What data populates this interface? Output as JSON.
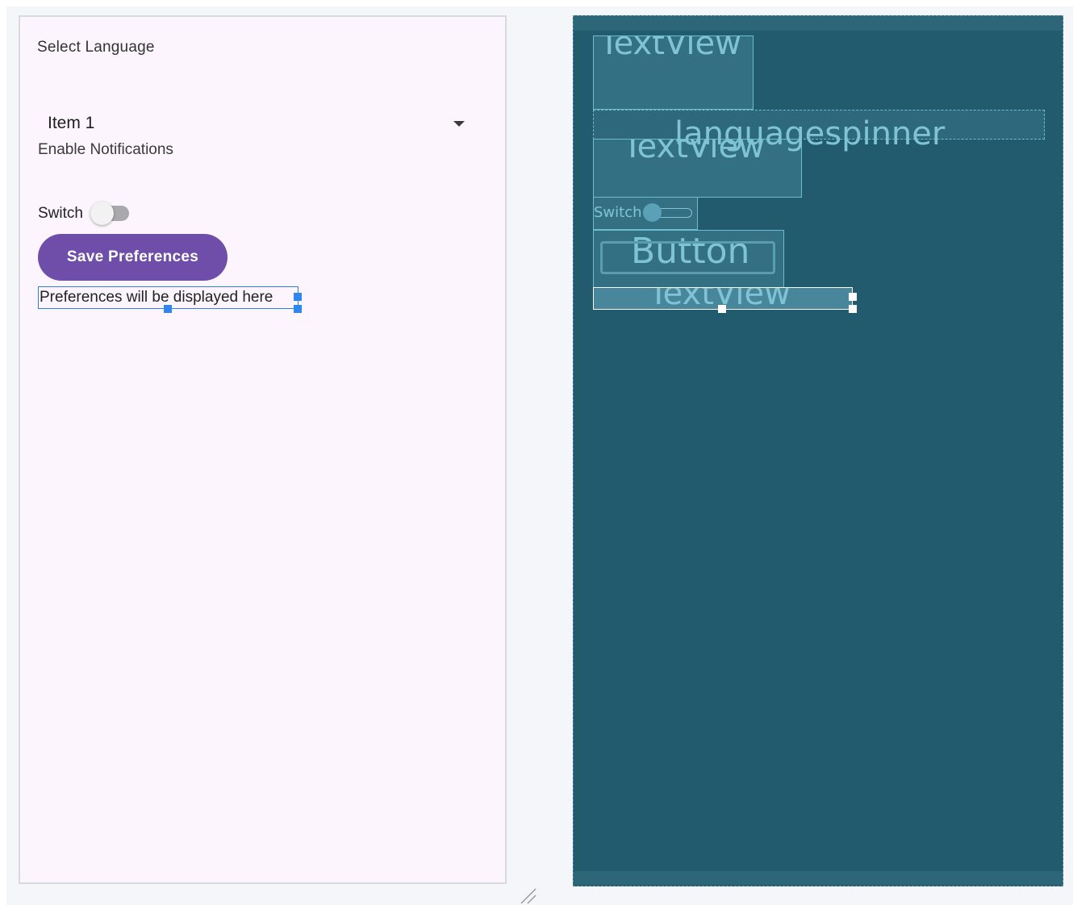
{
  "design": {
    "select_language_label": "Select Language",
    "spinner_selected_item": "Item 1",
    "enable_notifications_label": "Enable Notifications",
    "switch_label": "Switch",
    "switch_checked": false,
    "save_button_label": "Save Preferences",
    "preferences_text": "Preferences will be displayed here"
  },
  "blueprint": {
    "textview_label_1": "TextView",
    "spinner_label": "languagespinner",
    "textview_label_2": "TextView",
    "switch_label": "Switch",
    "button_label": "Button",
    "textview_label_3": "TextView"
  },
  "colors": {
    "design_background": "#fcf5fd",
    "button_purple": "#6e4ea8",
    "selection_blue": "#2f7ee6",
    "blueprint_background": "#225a6e",
    "blueprint_outline": "#6dbcd0"
  }
}
